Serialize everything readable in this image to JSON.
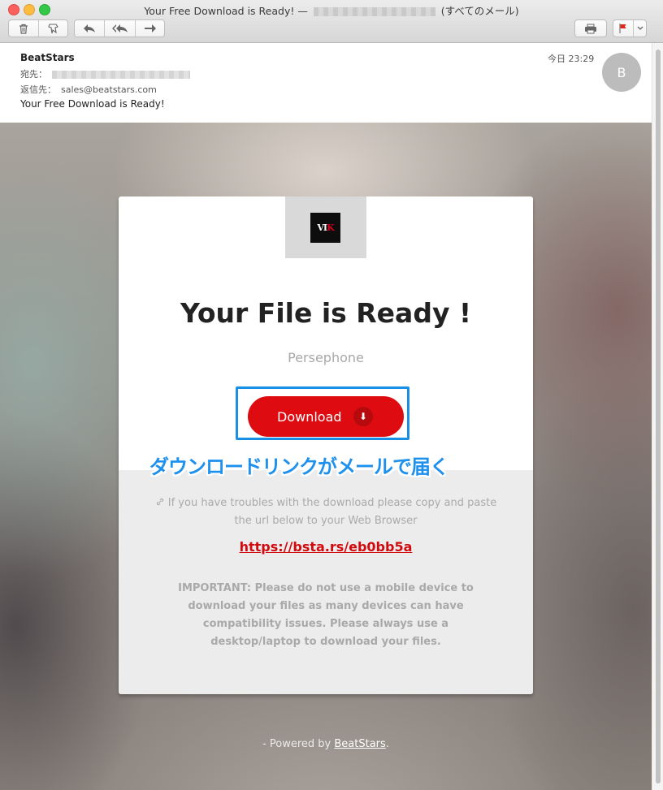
{
  "window": {
    "title_prefix": "Your Free Download is Ready! —",
    "title_suffix": "(すべてのメール)"
  },
  "toolbar": {
    "trash_icon": "trash-icon",
    "junk_icon": "junk-icon",
    "reply_icon": "reply-icon",
    "reply_all_icon": "reply-all-icon",
    "forward_icon": "forward-icon",
    "print_icon": "print-icon",
    "flag_icon": "flag-icon",
    "flag_color": "#e0271c"
  },
  "header": {
    "from": "BeatStars",
    "to_label": "宛先：",
    "reply_to_label": "返信先：",
    "reply_to_value": "sales@beatstars.com",
    "subject": "Your Free Download is Ready!",
    "time": "今日 23:29",
    "avatar_initial": "B"
  },
  "email": {
    "logo_text_a": "VI",
    "logo_text_b": "K",
    "title": "Your File is Ready !",
    "track_name": "Persephone",
    "download_label": "Download",
    "download_icon": "⬇",
    "trouble_text": "If you have troubles with the download please copy and paste the url below to your Web Browser",
    "link": "https://bsta.rs/eb0bb5a",
    "important_text": "IMPORTANT: Please do not use a mobile device to download your files as many devices can have compatibility issues. Please always use a desktop/laptop to download your files.",
    "footer_prefix": "- Powered by ",
    "footer_brand": "BeatStars",
    "footer_suffix": "."
  },
  "annotation": {
    "text": "ダウンロードリンクがメールで届く",
    "color": "#1e90ee"
  }
}
